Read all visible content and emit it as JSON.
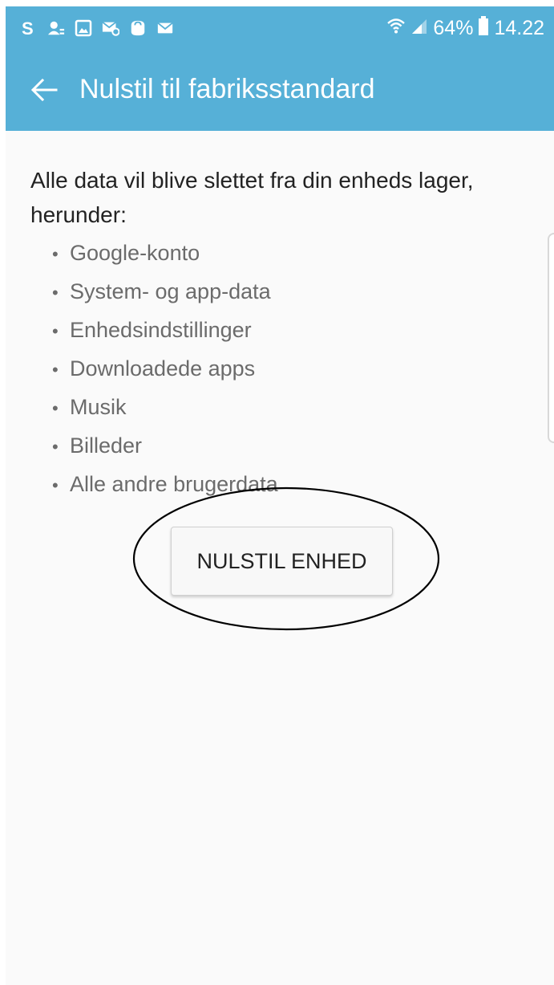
{
  "status_bar": {
    "left_icons": [
      "skype-icon",
      "contacts-sync-icon",
      "gallery-icon",
      "mail-settings-icon",
      "galaxy-apps-icon",
      "email-icon"
    ],
    "battery_percent": "64%",
    "time": "14.22",
    "colors": {
      "background": "#56b0d7",
      "foreground": "#ffffff"
    }
  },
  "app_bar": {
    "back_icon": "arrow-left-icon",
    "title": "Nulstil til fabriksstandard"
  },
  "content": {
    "description": "Alle data vil blive slettet fra din enheds lager, herunder:",
    "bullet_symbol": "•",
    "items": [
      {
        "label": "Google-konto"
      },
      {
        "label": "System- og app-data"
      },
      {
        "label": "Enhedsindstillinger"
      },
      {
        "label": "Downloadede apps"
      },
      {
        "label": "Musik"
      },
      {
        "label": "Billeder"
      },
      {
        "label": "Alle andre brugerdata"
      }
    ],
    "reset_button_label": "NULSTIL ENHED"
  },
  "annotation": {
    "type": "hand-drawn-ellipse",
    "color": "#000000"
  }
}
